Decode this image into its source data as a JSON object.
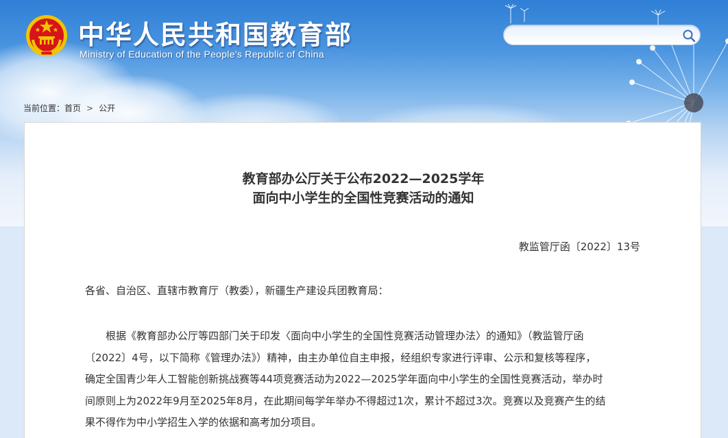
{
  "header": {
    "site_title": "中华人民共和国教育部",
    "site_subtitle": "Ministry of Education of the People's Republic of China",
    "emblem_icon": "national-emblem-icon"
  },
  "search": {
    "placeholder": "",
    "value": "",
    "icon": "search-icon"
  },
  "breadcrumb": {
    "prefix": "当前位置：",
    "items": [
      "首页",
      "公开"
    ],
    "separator": ">"
  },
  "article": {
    "title_line1": "教育部办公厅关于公布2022—2025学年",
    "title_line2": "面向中小学生的全国性竞赛活动的通知",
    "doc_number": "教监管厅函〔2022〕13号",
    "salutation": "各省、自治区、直辖市教育厅（教委），新疆生产建设兵团教育局：",
    "body_lines": [
      "　　根据《教育部办公厅等四部门关于印发〈面向中小学生的全国性竞赛活动管理办法〉的通知》（教监管厅函",
      "〔2022〕4号，以下简称《管理办法》）精神，由主办单位自主申报，经组织专家进行评审、公示和复核等程序，",
      "确定全国青少年人工智能创新挑战赛等44项竞赛活动为2022—2025学年面向中小学生的全国性竞赛活动，举办时",
      "间原则上为2022年9月至2025年8月，在此期间每学年举办不得超过1次，累计不超过3次。竞赛以及竞赛产生的结",
      "果不得作为中小学招生入学的依据和高考加分项目。"
    ]
  },
  "colors": {
    "sky_top": "#2f7fd6",
    "emblem_red": "#d7141a",
    "emblem_gold": "#f3c300",
    "text": "#333333"
  }
}
